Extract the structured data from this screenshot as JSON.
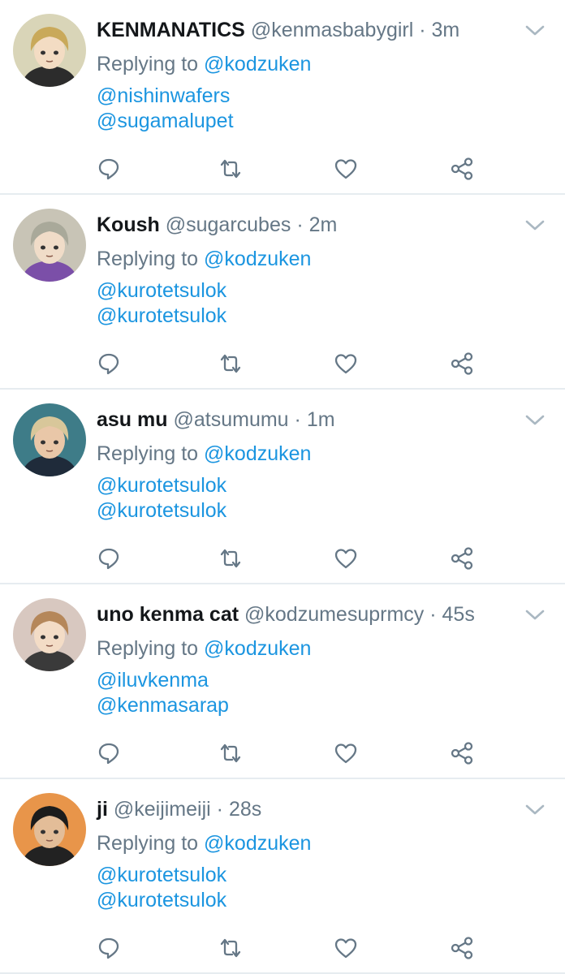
{
  "tweets": [
    {
      "name": "KENMANATICS",
      "handle": "@kenmasbabygirl",
      "time": "3m",
      "replying_label": "Replying to",
      "replying_to": "@kodzuken",
      "mentions": [
        "@nishinwafers",
        "@sugamalupet"
      ],
      "avatar": {
        "bg": "#d9d5b8",
        "hair": "#c9a95a",
        "skin": "#f3dcc3",
        "shirt": "#2c2c2c"
      }
    },
    {
      "name": "Koush",
      "handle": "@sugarcubes",
      "time": "2m",
      "replying_label": "Replying to",
      "replying_to": "@kodzuken",
      "mentions": [
        "@kurotetsulok",
        "@kurotetsulok"
      ],
      "avatar": {
        "bg": "#c8c4b6",
        "hair": "#a9a99a",
        "skin": "#f0dcc8",
        "shirt": "#7b4fa8"
      }
    },
    {
      "name": "asu mu",
      "handle": "@atsumumu",
      "time": "1m",
      "replying_label": "Replying to",
      "replying_to": "@kodzuken",
      "mentions": [
        "@kurotetsulok",
        "@kurotetsulok"
      ],
      "avatar": {
        "bg": "#3e7c88",
        "hair": "#d8c79a",
        "skin": "#e9c7a8",
        "shirt": "#1f2b3a"
      }
    },
    {
      "name": "uno kenma cat",
      "handle": "@kodzumesuprmcy",
      "time": "45s",
      "replying_label": "Replying to",
      "replying_to": "@kodzuken",
      "mentions": [
        "@iluvkenma",
        "@kenmasarap"
      ],
      "avatar": {
        "bg": "#d8c8c0",
        "hair": "#b5875a",
        "skin": "#f3dcc6",
        "shirt": "#3a3a3a"
      }
    },
    {
      "name": "ji",
      "handle": "@keijimeiji",
      "time": "28s",
      "replying_label": "Replying to",
      "replying_to": "@kodzuken",
      "mentions": [
        "@kurotetsulok",
        "@kurotetsulok"
      ],
      "avatar": {
        "bg": "#e8954a",
        "hair": "#1c1c1c",
        "skin": "#e3bd98",
        "shirt": "#222222"
      }
    }
  ],
  "colors": {
    "name": "#14171a",
    "meta": "#657786",
    "link": "#1b95e0",
    "divider": "#e6ecf0"
  },
  "icons": {
    "reply": "reply-icon",
    "retweet": "retweet-icon",
    "like": "heart-icon",
    "share": "share-icon",
    "menu": "chevron-down-icon"
  }
}
